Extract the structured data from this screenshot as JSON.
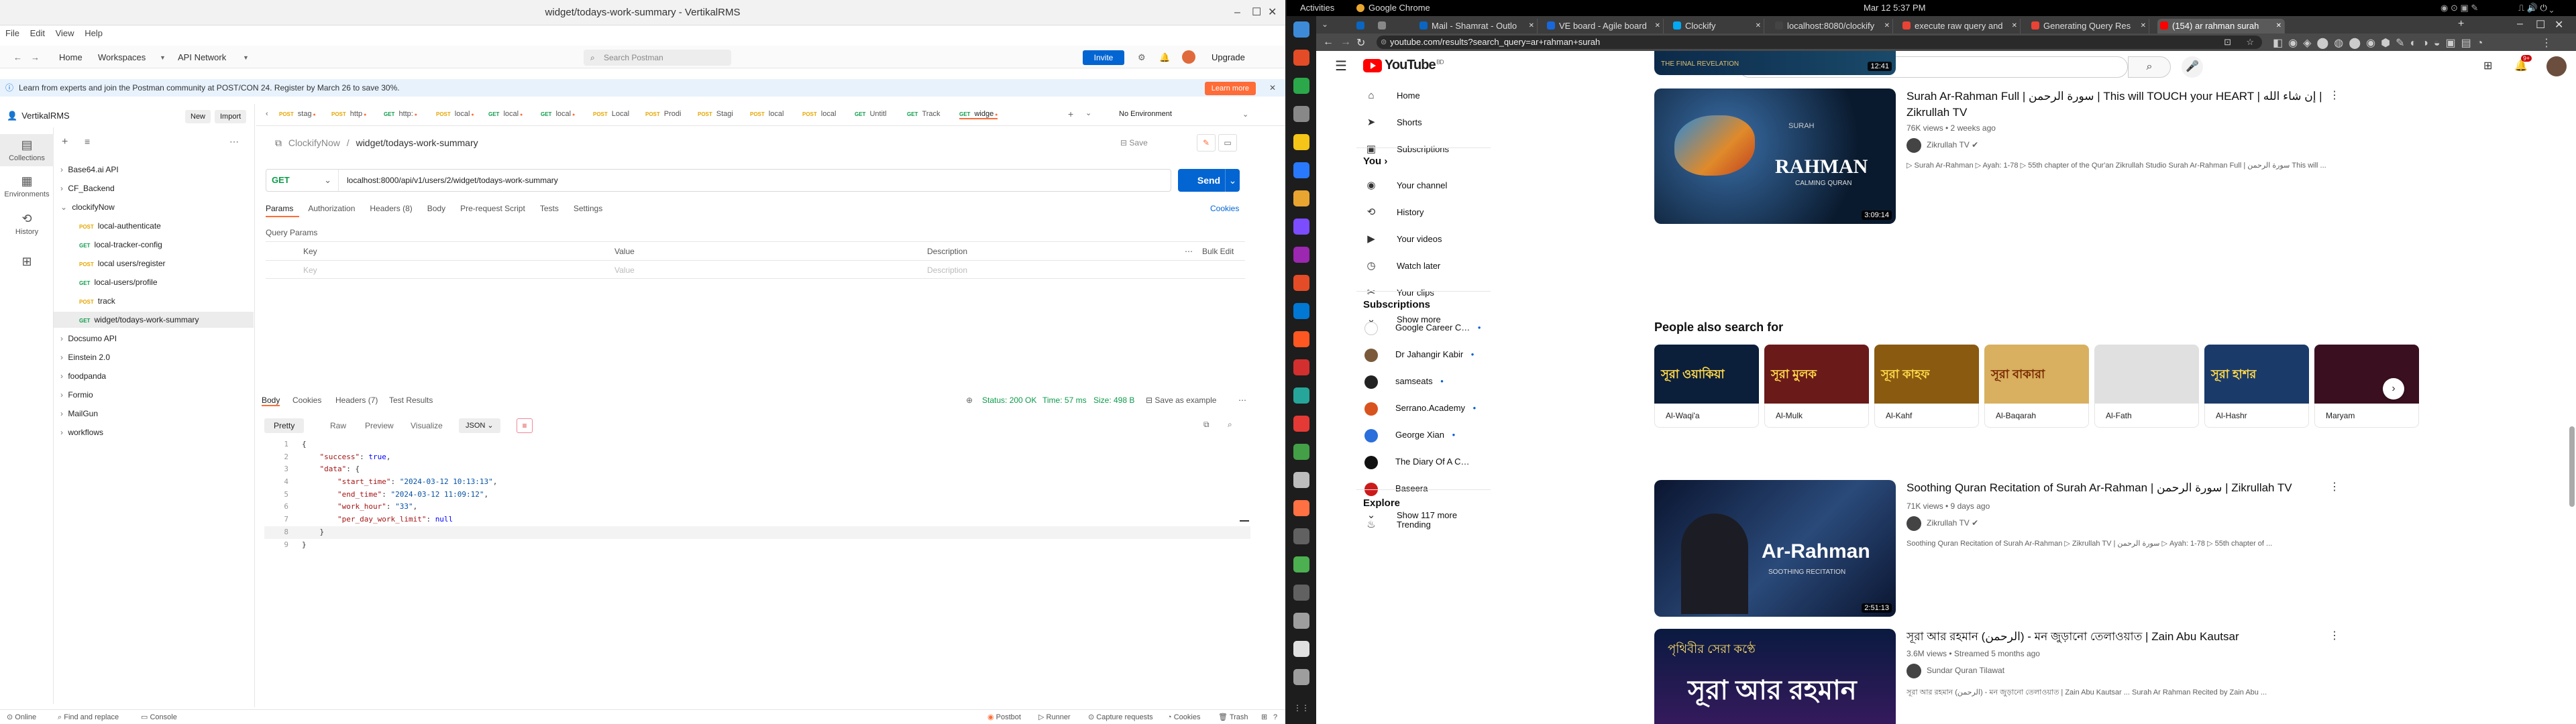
{
  "postman": {
    "window_title": "widget/todays-work-summary - VertikalRMS",
    "menu": [
      "File",
      "Edit",
      "View",
      "Help"
    ],
    "header": {
      "home": "Home",
      "workspaces": "Workspaces",
      "api_network": "API Network",
      "search_placeholder": "Search Postman",
      "invite": "Invite",
      "upgrade": "Upgrade"
    },
    "banner": {
      "text": "Learn from experts and join the Postman community at POST/CON 24. Register by March 26 to save 30%.",
      "learn_more": "Learn more"
    },
    "rail": [
      "Collections",
      "Environments",
      "History"
    ],
    "workspace_name": "VertikalRMS",
    "new_btn": "New",
    "import_btn": "Import",
    "tree": [
      {
        "label": "Base64.ai API",
        "method": "",
        "indent": 1,
        "caret": "›"
      },
      {
        "label": "CF_Backend",
        "method": "",
        "indent": 1,
        "caret": "›"
      },
      {
        "label": "clockifyNow",
        "method": "",
        "indent": 1,
        "caret": "⌄"
      },
      {
        "label": "local-authenticate",
        "method": "POST",
        "indent": 2,
        "caret": ""
      },
      {
        "label": "local-tracker-config",
        "method": "GET",
        "indent": 2,
        "caret": ""
      },
      {
        "label": "local users/register",
        "method": "POST",
        "indent": 2,
        "caret": ""
      },
      {
        "label": "local-users/profile",
        "method": "GET",
        "indent": 2,
        "caret": ""
      },
      {
        "label": "track",
        "method": "POST",
        "indent": 2,
        "caret": ""
      },
      {
        "label": "widget/todays-work-summary",
        "method": "GET",
        "indent": 2,
        "caret": "",
        "selected": true
      },
      {
        "label": "Docsumo API",
        "method": "",
        "indent": 1,
        "caret": "›"
      },
      {
        "label": "Einstein 2.0",
        "method": "",
        "indent": 1,
        "caret": "›"
      },
      {
        "label": "foodpanda",
        "method": "",
        "indent": 1,
        "caret": "›"
      },
      {
        "label": "Formio",
        "method": "",
        "indent": 1,
        "caret": "›"
      },
      {
        "label": "MailGun",
        "method": "",
        "indent": 1,
        "caret": "›"
      },
      {
        "label": "workflows",
        "method": "",
        "indent": 1,
        "caret": "›"
      }
    ],
    "req_tabs": [
      "stag",
      "http",
      "http:",
      "local",
      "local",
      "local",
      "Local",
      "Prodi",
      "Stagi",
      "local",
      "local",
      "Untitl",
      "Track",
      "widge"
    ],
    "req_tab_methods": [
      "POST",
      "POST",
      "GET",
      "POST",
      "GET",
      "GET",
      "POST",
      "POST",
      "POST",
      "POST",
      "POST",
      "GET",
      "GET",
      "GET"
    ],
    "no_env": "No Environment",
    "breadcrumb": {
      "collection": "ClockifyNow",
      "request": "widget/todays-work-summary"
    },
    "save": "Save",
    "method": "GET",
    "url": "localhost:8000/api/v1/users/2/widget/todays-work-summary",
    "send": "Send",
    "request_tabs": [
      "Params",
      "Authorization",
      "Headers (8)",
      "Body",
      "Pre-request Script",
      "Tests",
      "Settings"
    ],
    "cookies": "Cookies",
    "query_params_label": "Query Params",
    "query_headers": [
      "Key",
      "Value",
      "Description"
    ],
    "bulk_edit": "Bulk Edit",
    "query_placeholders": [
      "Key",
      "Value",
      "Description"
    ],
    "response_tabs": [
      "Body",
      "Cookies",
      "Headers (7)",
      "Test Results"
    ],
    "status": "Status: 200 OK",
    "time": "Time: 57 ms",
    "size": "Size: 498 B",
    "save_example": "Save as example",
    "view_modes": [
      "Pretty",
      "Raw",
      "Preview",
      "Visualize"
    ],
    "format": "JSON",
    "code_lines": [
      "{",
      "    \"success\": true,",
      "    \"data\": {",
      "        \"start_time\": \"2024-03-12 10:13:13\",",
      "        \"end_time\": \"2024-03-12 11:09:12\",",
      "        \"work_hour\": \"33\",",
      "        \"per_day_work_limit\": null",
      "    }",
      "}"
    ],
    "statusbar": [
      "Online",
      "Find and replace",
      "Console",
      "Postbot",
      "Runner",
      "Capture requests",
      "Cookies",
      "Trash"
    ]
  },
  "gnome": {
    "activities": "Activities",
    "app": "Google Chrome",
    "clock": "Mar 12  5:37 PM"
  },
  "chrome": {
    "tabs": [
      "Mail - Shamrat - Outlo",
      "VE board - Agile board",
      "Clockify",
      "localhost:8080/clockify",
      "execute raw query and",
      "Generating Query Res",
      "(154) ar rahman surah"
    ],
    "tab_colors": [
      "#0a66c2",
      "#1868db",
      "#03a9f4",
      "#444444",
      "#ea4335",
      "#ea4335",
      "#ff0000"
    ],
    "url": "youtube.com/results?search_query=ar+rahman+surah"
  },
  "youtube": {
    "search_placeholder": "Search",
    "side": {
      "main": [
        "Home",
        "Shorts",
        "Subscriptions"
      ],
      "you_header": "You",
      "you": [
        "Your channel",
        "History",
        "Your videos",
        "Watch later",
        "Your clips",
        "Show more"
      ],
      "subs_header": "Subscriptions",
      "subs": [
        "Google Career C…",
        "Dr Jahangir Kabir",
        "samseats",
        "Serrano.Academy",
        "George Xian",
        "The Diary Of A C…",
        "Baseera",
        "Show 117 more"
      ],
      "sub_colors": [
        "#ffffff",
        "#7a5a3a",
        "#222222",
        "#d9531e",
        "#2a6fdb",
        "#111111",
        "#cc1a1a",
        ""
      ],
      "explore_header": "Explore",
      "explore": [
        "Trending"
      ]
    },
    "top_thumb_duration": "12:41",
    "top_thumb_caption": "THE FINAL REVELATION",
    "videos": [
      {
        "title": "Surah Ar-Rahman Full | سورة الرحمن | This will TOUCH your HEART | إن شاء الله | Zikrullah TV",
        "meta": "76K views • 2 weeks ago",
        "channel": "Zikrullah TV",
        "desc": "▷ Surah Ar-Rahman ▷ Ayah: 1-78 ▷ 55th chapter of the Qur'an Zikrullah Studio Surah Ar-Rahman Full | سورة الرحمن This will ...",
        "duration": "3:09:14",
        "thumb_title": "RAHMAN",
        "thumb_sub": "SURAH",
        "thumb_tag": "CALMING QURAN"
      },
      {
        "title": "Soothing Quran Recitation of Surah Ar-Rahman | سورة الرحمن | Zikrullah TV",
        "meta": "71K views • 9 days ago",
        "channel": "Zikrullah TV",
        "desc": "Soothing Quran Recitation of Surah Ar-Rahman ▷ Zikrullah TV | سورة الرحمن ▷ Ayah: 1-78 ▷ 55th chapter of ...",
        "duration": "2:51:13",
        "thumb_title": "Ar-Rahman",
        "thumb_sub": "",
        "thumb_tag": "SOOTHING RECITATION"
      },
      {
        "title": "সূরা আর রহমান (الرحمن) - মন জুড়ানো তেলাওয়াত | Zain Abu Kautsar",
        "meta": "3.6M views • Streamed 5 months ago",
        "channel": "Sundar Quran Tilawat",
        "desc": "সূরা আর রহমান (الرحمن) - মন জুড়ানো তেলাওয়াত | Zain Abu Kautsar ... Surah Ar Rahman Recited by Zain Abu ...",
        "duration": "",
        "thumb_title": "সূরা আর রহমান",
        "thumb_sub": "পৃথিবীর সেরা কণ্ঠে",
        "thumb_tag": ""
      }
    ],
    "pasf_title": "People also search for",
    "pasf": [
      "Al-Waqi'a",
      "Al-Mulk",
      "Al-Kahf",
      "Al-Baqarah",
      "Al-Fath",
      "Al-Hashr",
      "Maryam"
    ],
    "pasf_thumb_text": [
      "সূরা ওয়াকিয়া",
      "সূরা মুলক",
      "সূরা কাহফ",
      "সূরা বাকারা",
      "",
      "সূরা হাশর",
      ""
    ],
    "pasf_colors": [
      "#0b1e3a",
      "#6b1a1a",
      "#8a5a10",
      "#d8b060",
      "#e0e0e0",
      "#1a3a6a",
      "#3a1020"
    ]
  }
}
